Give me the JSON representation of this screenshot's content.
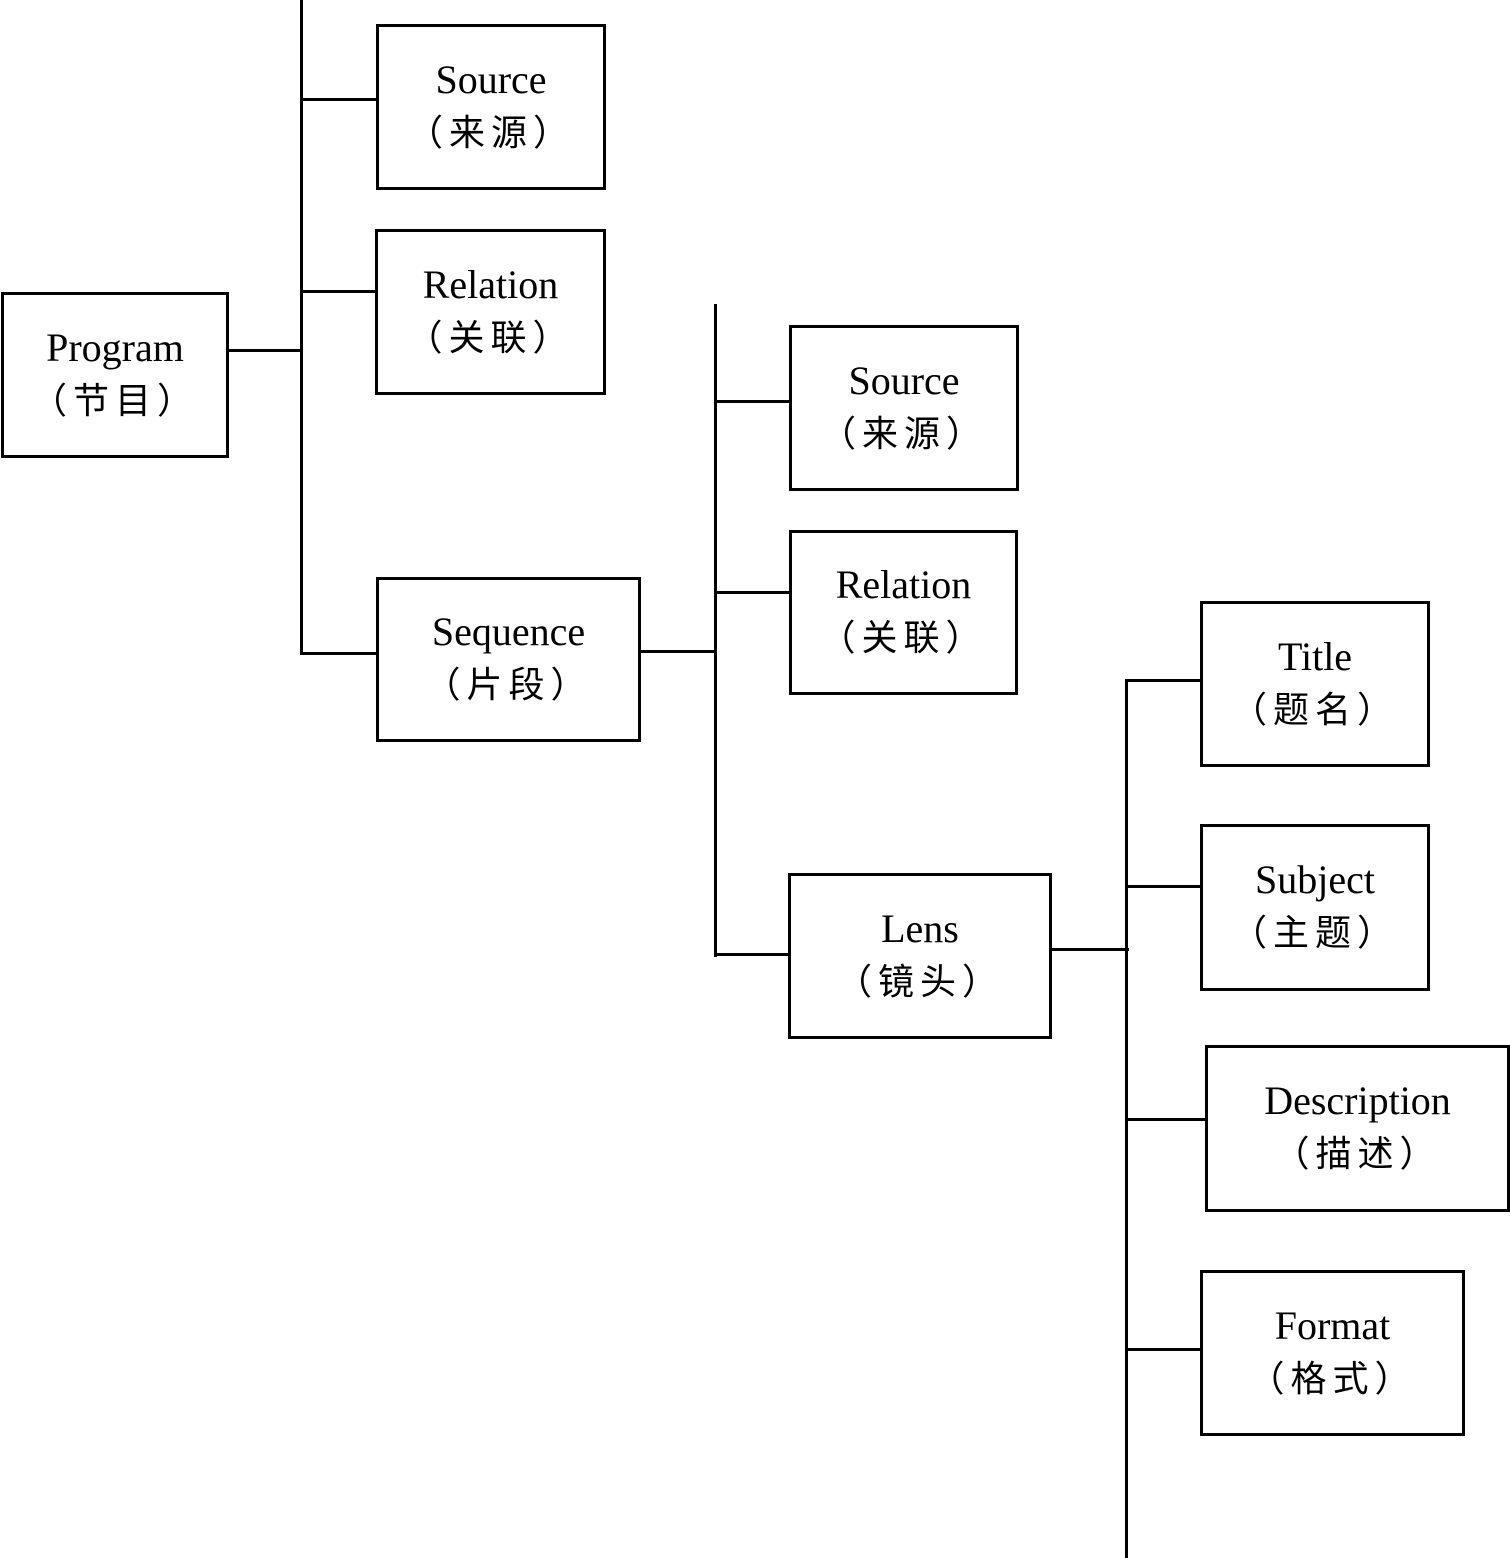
{
  "diagram": {
    "type": "tree",
    "nodes": {
      "program": {
        "en": "Program",
        "zh": "（节目）"
      },
      "program_source": {
        "en": "Source",
        "zh": "（来源）"
      },
      "program_relation": {
        "en": "Relation",
        "zh": "（关联）"
      },
      "sequence": {
        "en": "Sequence",
        "zh": "（片段）"
      },
      "sequence_source": {
        "en": "Source",
        "zh": "（来源）"
      },
      "sequence_relation": {
        "en": "Relation",
        "zh": "（关联）"
      },
      "lens": {
        "en": "Lens",
        "zh": "（镜头）"
      },
      "title": {
        "en": "Title",
        "zh": "（题名）"
      },
      "subject": {
        "en": "Subject",
        "zh": "（主题）"
      },
      "description": {
        "en": "Description",
        "zh": "（描述）"
      },
      "format": {
        "en": "Format",
        "zh": "（格式）"
      }
    },
    "edges": [
      [
        "program",
        "program_source"
      ],
      [
        "program",
        "program_relation"
      ],
      [
        "program",
        "sequence"
      ],
      [
        "sequence",
        "sequence_source"
      ],
      [
        "sequence",
        "sequence_relation"
      ],
      [
        "sequence",
        "lens"
      ],
      [
        "lens",
        "title"
      ],
      [
        "lens",
        "subject"
      ],
      [
        "lens",
        "description"
      ],
      [
        "lens",
        "format"
      ]
    ]
  }
}
